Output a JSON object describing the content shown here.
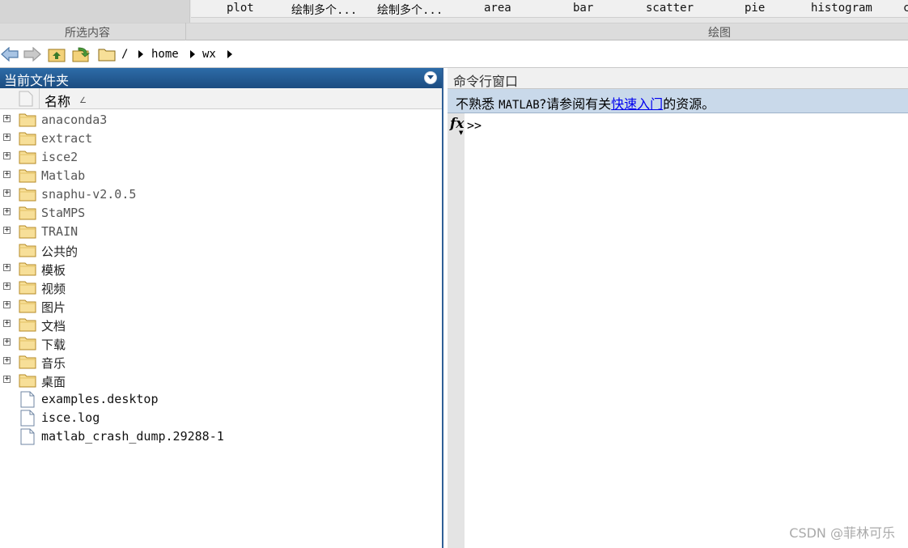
{
  "toolstrip": {
    "plot_gallery": [
      "plot",
      "绘制多个...",
      "绘制多个...",
      "area",
      "bar",
      "scatter",
      "pie",
      "histogram",
      "c"
    ],
    "sections": {
      "selection": "所选内容",
      "plots": "绘图"
    }
  },
  "address_bar": {
    "root": "/",
    "path": [
      "home",
      "wx"
    ]
  },
  "current_folder": {
    "title": "当前文件夹",
    "column_name": "名称",
    "sort_indicator": "∠",
    "items": [
      {
        "label": "anaconda3",
        "type": "folder",
        "expandable": true,
        "mono": true
      },
      {
        "label": "extract",
        "type": "folder",
        "expandable": true,
        "mono": true
      },
      {
        "label": "isce2",
        "type": "folder",
        "expandable": true,
        "mono": true
      },
      {
        "label": "Matlab",
        "type": "folder",
        "expandable": true,
        "mono": true
      },
      {
        "label": "snaphu-v2.0.5",
        "type": "folder",
        "expandable": true,
        "mono": true
      },
      {
        "label": "StaMPS",
        "type": "folder",
        "expandable": true,
        "mono": true
      },
      {
        "label": "TRAIN",
        "type": "folder",
        "expandable": true,
        "mono": true
      },
      {
        "label": "公共的",
        "type": "folder",
        "expandable": false,
        "mono": false
      },
      {
        "label": "模板",
        "type": "folder",
        "expandable": true,
        "mono": false
      },
      {
        "label": "视频",
        "type": "folder",
        "expandable": true,
        "mono": false
      },
      {
        "label": "图片",
        "type": "folder",
        "expandable": true,
        "mono": false
      },
      {
        "label": "文档",
        "type": "folder",
        "expandable": true,
        "mono": false
      },
      {
        "label": "下载",
        "type": "folder",
        "expandable": true,
        "mono": false
      },
      {
        "label": "音乐",
        "type": "folder",
        "expandable": true,
        "mono": false
      },
      {
        "label": "桌面",
        "type": "folder",
        "expandable": true,
        "mono": false
      },
      {
        "label": "examples.desktop",
        "type": "file",
        "expandable": false,
        "mono": true
      },
      {
        "label": "isce.log",
        "type": "file",
        "expandable": false,
        "mono": true
      },
      {
        "label": "matlab_crash_dump.29288-1",
        "type": "file",
        "expandable": false,
        "mono": true
      }
    ]
  },
  "command_window": {
    "title": "命令行窗口",
    "info_prefix": "不熟悉 ",
    "info_product": "MATLAB",
    "info_middle": "?请参阅有关",
    "info_link": "快速入门",
    "info_suffix": "的资源。",
    "fx_label": "fx",
    "prompt": ">>"
  },
  "watermark": "CSDN @菲林可乐",
  "colors": {
    "panel_header": "#1c4c80",
    "info_bar": "#c9d9ea",
    "link": "#0000ee",
    "folder": "#f3d27a"
  }
}
